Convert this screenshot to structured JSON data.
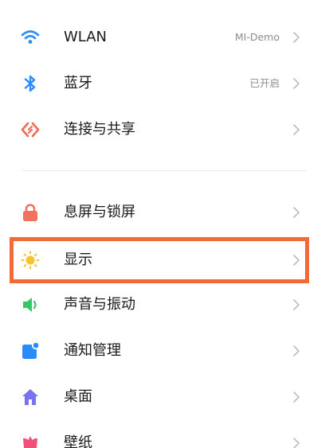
{
  "settings": {
    "connectivity": [
      {
        "label": "WLAN",
        "value": "MI-Demo",
        "icon": "wifi-icon",
        "color": "#2a8cf6"
      },
      {
        "label": "蓝牙",
        "value": "已开启",
        "icon": "bluetooth-icon",
        "color": "#2a8cf6"
      },
      {
        "label": "连接与共享",
        "value": "",
        "icon": "connection-share-icon",
        "color": "#f26a4f"
      }
    ],
    "device": [
      {
        "label": "息屏与锁屏",
        "value": "",
        "icon": "lock-icon",
        "color": "#f0735f"
      },
      {
        "label": "显示",
        "value": "",
        "icon": "sun-icon",
        "color": "#f7c32e"
      },
      {
        "label": "声音与振动",
        "value": "",
        "icon": "speaker-icon",
        "color": "#35c768"
      },
      {
        "label": "通知管理",
        "value": "",
        "icon": "notification-icon",
        "color": "#2a8cf6"
      },
      {
        "label": "桌面",
        "value": "",
        "icon": "home-icon",
        "color": "#7a73f0"
      },
      {
        "label": "壁纸",
        "value": "",
        "icon": "wallpaper-icon",
        "color": "#f0507a"
      }
    ]
  },
  "highlight": {
    "color": "#f26a35",
    "target": "显示"
  }
}
